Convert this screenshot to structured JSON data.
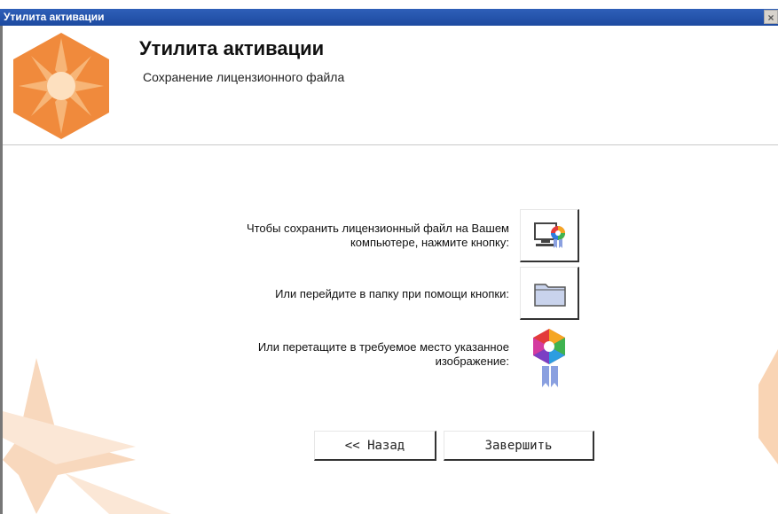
{
  "window": {
    "title": "Утилита активации",
    "close_glyph": "×"
  },
  "header": {
    "title": "Утилита активации",
    "subtitle": "Сохранение лицензионного файла"
  },
  "rows": [
    {
      "line1": "Чтобы сохранить лицензионный файл на Вашем",
      "line2": "компьютере, нажмите кнопку:",
      "icon": "save-license-icon"
    },
    {
      "line1": "Или перейдите в папку при помощи кнопки:",
      "icon": "folder-icon"
    },
    {
      "line1": "Или перетащите в требуемое место указанное",
      "line2": "изображение:",
      "icon": "license-badge-icon"
    }
  ],
  "buttons": {
    "back": "<< Назад",
    "finish": "Завершить"
  },
  "colors": {
    "accent": "#f08a3c",
    "titlebar": "#2e5fb8"
  }
}
